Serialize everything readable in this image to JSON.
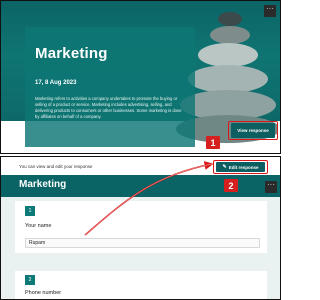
{
  "top": {
    "form_title": "Marketing",
    "date": "17, 8 Aug 2023",
    "description": "Marketing refers to activities a company undertakes to promote the buying or selling of a product or service. Marketing includes advertising, selling, and delivering products to consumers or other businesses. Some marketing is done by affiliates on behalf of a company.",
    "view_response_label": "View response",
    "step_badge": "1",
    "more_glyph": "···"
  },
  "bottom": {
    "info_text": "You can view and edit your response",
    "edit_response_label": "Edit response",
    "step_badge": "2",
    "form_title": "Marketing",
    "more_glyph": "···",
    "questions": [
      {
        "number": "1",
        "label": "Your name",
        "answer": "Rupam"
      },
      {
        "number": "2",
        "label": "Phone number"
      }
    ]
  },
  "colors": {
    "teal": "#0a6466",
    "annotation_red": "#d81818"
  },
  "icons": {
    "edit": "pencil-icon",
    "more": "more-options-icon",
    "arrow": "annotation-arrow"
  }
}
